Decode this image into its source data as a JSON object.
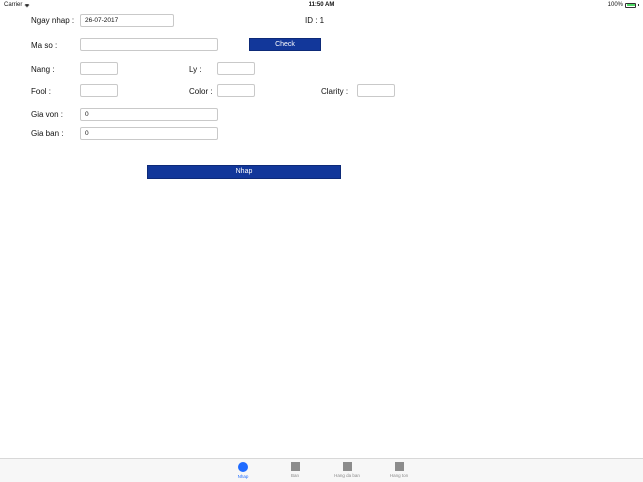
{
  "status_bar": {
    "carrier": "Carrier",
    "time": "11:50 AM",
    "battery": "100%",
    "colors": {
      "battery_fill": "#4cd964"
    }
  },
  "form": {
    "ngay_nhap_label": "Ngay nhap :",
    "ngay_nhap_value": "26-07-2017",
    "id_label": "ID : 1",
    "ma_so_label": "Ma so :",
    "ma_so_value": "",
    "check_label": "Check",
    "nang_label": "Nang :",
    "nang_value": "",
    "ly_label": "Ly :",
    "ly_value": "",
    "fool_label": "Fool :",
    "fool_value": "",
    "color_label": "Color :",
    "color_value": "",
    "clarity_label": "Clarity :",
    "clarity_value": "",
    "gia_von_label": "Gia von :",
    "gia_von_value": "0",
    "gia_ban_label": "Gia ban :",
    "gia_ban_value": "0",
    "nhap_button": "Nhap",
    "colors": {
      "button": "#12379a"
    }
  },
  "tab_bar": {
    "tabs": [
      {
        "label": "Nhap",
        "icon": "circle-icon",
        "active": true
      },
      {
        "label": "Ban",
        "icon": "square-icon",
        "active": false
      },
      {
        "label": "Hang da ban",
        "icon": "square-icon",
        "active": false
      },
      {
        "label": "Hang ton",
        "icon": "square-icon",
        "active": false
      }
    ],
    "colors": {
      "active": "#1f6bff",
      "inactive": "#8a8a8a"
    }
  }
}
